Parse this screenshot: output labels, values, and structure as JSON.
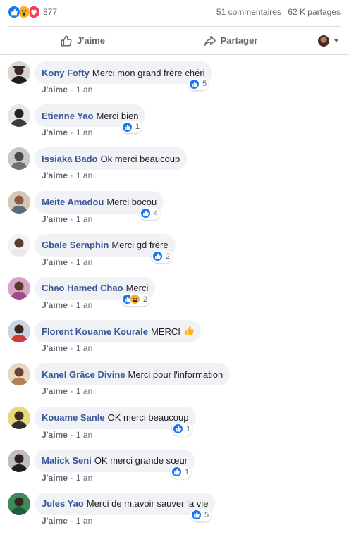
{
  "stats": {
    "reaction_count": "877",
    "comments": "51 commentaires",
    "shares": "62 K partages"
  },
  "actions": {
    "like_label": "J'aime",
    "share_label": "Partager"
  },
  "comment_meta": {
    "like": "J'aime",
    "time": "1 an",
    "dot": "·"
  },
  "comments": [
    {
      "author": "Kony Fofty",
      "text": "Merci mon grand frère chéri",
      "reactions": "5"
    },
    {
      "author": "Etienne Yao",
      "text": "Merci bien",
      "reactions": "1"
    },
    {
      "author": "Issiaka Bado",
      "text": "Ok merci beaucoup",
      "reactions": ""
    },
    {
      "author": "Meite Amadou",
      "text": "Merci bocou",
      "reactions": "4"
    },
    {
      "author": "Gbale Seraphin",
      "text": "Merci gd frère",
      "reactions": "2"
    },
    {
      "author": "Chao Hamed Chao",
      "text": "Merci",
      "reactions": "2"
    },
    {
      "author": "Florent Kouame Kourale",
      "text": "MERCI",
      "reactions": ""
    },
    {
      "author": "Kanel Grâce Divine",
      "text": "Merci pour l'information",
      "reactions": ""
    },
    {
      "author": "Kouame Sanle",
      "text": "OK merci beaucoup",
      "reactions": "1"
    },
    {
      "author": "Malick Seni",
      "text": "OK merci grande sœur",
      "reactions": "1"
    },
    {
      "author": "Jules Yao",
      "text": "Merci de m,avoir sauver la vie",
      "reactions": "5"
    }
  ],
  "colors": {
    "author": "#385898",
    "like_blue": "#1877f2",
    "love_red": "#f33e58",
    "wow_yellow": "#f7b125",
    "bubble_bg": "#f0f2f5",
    "meta_gray": "#606770"
  },
  "icons": {
    "like": "thumbs-up-icon",
    "wow": "wow-face-icon",
    "love": "heart-icon",
    "share": "share-arrow-icon",
    "haha": "haha-face-icon",
    "thumb_emoji": "thumbs-up-emoji-icon"
  }
}
